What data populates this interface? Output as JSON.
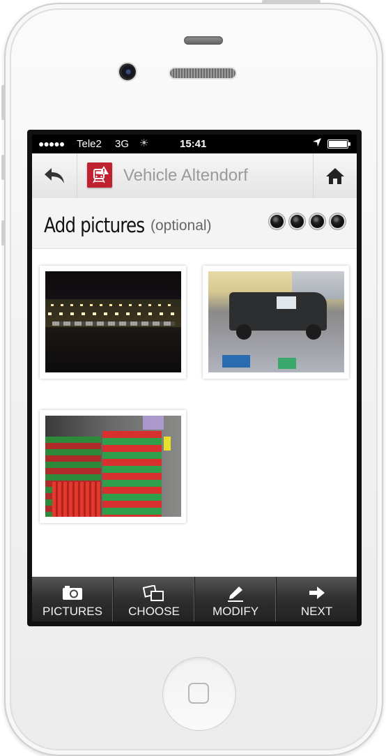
{
  "status_bar": {
    "signal": "●●●●●",
    "carrier": "Tele2",
    "network": "3G",
    "activity": "☀",
    "time": "15:41"
  },
  "nav": {
    "title": "Vehicle Altendorf",
    "back_icon": "back-arrow-icon",
    "home_icon": "home-icon",
    "logo_icon": "train-warning-logo"
  },
  "header": {
    "title": "Add pictures",
    "subtitle": "(optional)",
    "progress": {
      "total_steps": 4
    }
  },
  "photos": [
    {
      "subject": "night-building-photo"
    },
    {
      "subject": "vehicle-garage-photo"
    },
    {
      "subject": "stacked-baskets-photo"
    }
  ],
  "toolbar": {
    "items": [
      {
        "label": "PICTURES",
        "icon": "camera-icon"
      },
      {
        "label": "CHOOSE",
        "icon": "choose-photos-icon"
      },
      {
        "label": "MODIFY",
        "icon": "pencil-icon"
      },
      {
        "label": "NEXT",
        "icon": "arrow-right-icon"
      }
    ]
  },
  "colors": {
    "brand_red": "#c0212e",
    "toolbar_dark": "#2f2f2f",
    "nav_title_gray": "#9a9a9a"
  }
}
